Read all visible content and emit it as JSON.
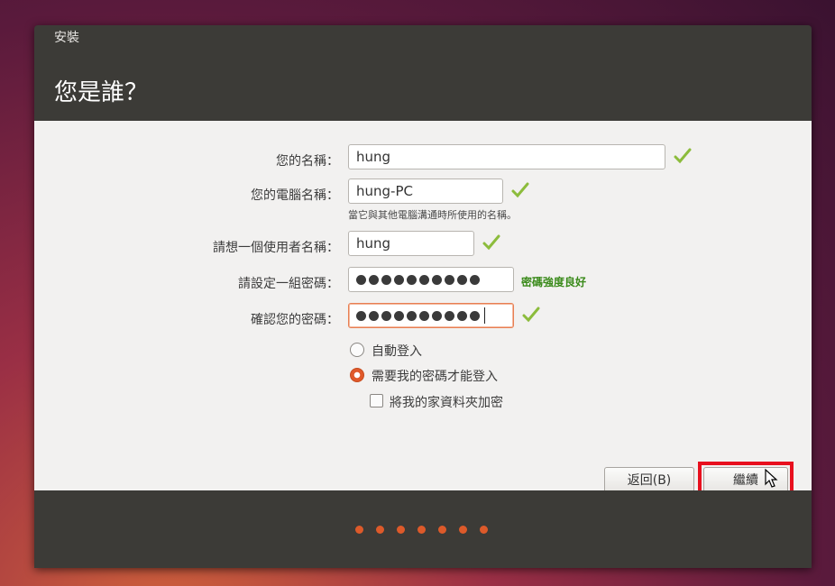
{
  "window": {
    "title": "安裝",
    "heading": "您是誰？"
  },
  "form": {
    "name_label": "您的名稱：",
    "name_value": "hung",
    "computer_label": "您的電腦名稱：",
    "computer_value": "hung-PC",
    "computer_hint": "當它與其他電腦溝通時所使用的名稱。",
    "username_label": "請想一個使用者名稱：",
    "username_value": "hung",
    "password_label": "請設定一組密碼：",
    "password_strength": "密碼強度良好",
    "confirm_label": "確認您的密碼：",
    "password_length": 10
  },
  "options": {
    "auto_login": "自動登入",
    "require_password": "需要我的密碼才能登入",
    "encrypt_home": "將我的家資料夾加密"
  },
  "buttons": {
    "back": "返回(B)",
    "continue": "繼續"
  },
  "colors": {
    "accent": "#dd5a2a",
    "highlight": "#e8101e",
    "check": "#8cbc3c"
  },
  "progress": {
    "steps": 7
  }
}
